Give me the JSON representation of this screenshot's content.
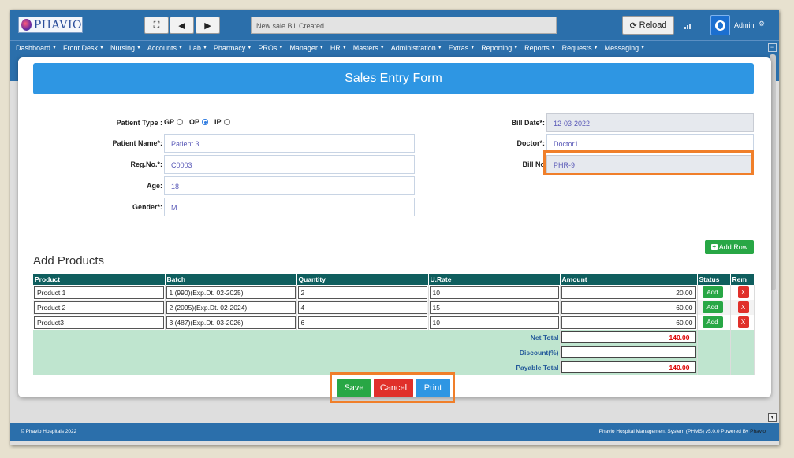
{
  "header": {
    "brand": "PHAVIO",
    "notification": "New sale Bill Created",
    "reload_label": "Reload",
    "user_name": "Admin"
  },
  "menu": [
    "Dashboard",
    "Front Desk",
    "Nursing",
    "Accounts",
    "Lab",
    "Pharmacy",
    "PROs",
    "Manager",
    "HR",
    "Masters",
    "Administration",
    "Extras",
    "Reporting",
    "Reports",
    "Requests",
    "Messaging"
  ],
  "form": {
    "title": "Sales Entry Form",
    "patient_type_label": "Patient Type :",
    "patient_type_options": [
      "GP",
      "OP",
      "IP"
    ],
    "patient_type_selected": "OP",
    "patient_name_label": "Patient Name*:",
    "patient_name": "Patient 3",
    "regno_label": "Reg.No.*:",
    "regno": "C0003",
    "age_label": "Age:",
    "age": "18",
    "gender_label": "Gender*:",
    "gender": "M",
    "bill_date_label": "Bill Date*:",
    "bill_date": "12-03-2022",
    "doctor_label": "Doctor*:",
    "doctor": "Doctor1",
    "bill_no_label": "Bill No",
    "bill_no": "PHR-9"
  },
  "products": {
    "section_title": "Add Products",
    "add_row_label": "Add Row",
    "columns": [
      "Product",
      "Batch",
      "Quantity",
      "U.Rate",
      "Amount",
      "Status",
      "Rem"
    ],
    "rows": [
      {
        "product": "Product 1",
        "batch": "1 (990)(Exp.Dt. 02-2025)",
        "quantity": "2",
        "rate": "10",
        "amount": "20.00",
        "status_btn": "Add",
        "remove_btn": "X"
      },
      {
        "product": "Product 2",
        "batch": "2 (2095)(Exp.Dt. 02-2024)",
        "quantity": "4",
        "rate": "15",
        "amount": "60.00",
        "status_btn": "Add",
        "remove_btn": "X"
      },
      {
        "product": "Product3",
        "batch": "3 (487)(Exp.Dt. 03-2026)",
        "quantity": "6",
        "rate": "10",
        "amount": "60.00",
        "status_btn": "Add",
        "remove_btn": "X"
      }
    ],
    "net_total_label": "Net Total",
    "net_total": "140.00",
    "discount_label": "Discount(%)",
    "discount": "",
    "payable_label": "Payable Total",
    "payable_total": "140.00"
  },
  "actions": {
    "save": "Save",
    "cancel": "Cancel",
    "print": "Print"
  },
  "footer": {
    "left": "© Phavio Hospitals 2022",
    "right": "Phavio Hospital Management System (PHMS) v5.0.0 Powered By",
    "right_brand": "Phavio"
  },
  "colors": {
    "primary": "#2b6fab",
    "title_bar": "#2e96e3",
    "table_header": "#0f5e5e",
    "totals_bg": "#bfe5cf",
    "success": "#28a745",
    "danger": "#e0302a",
    "highlight": "#f07f2a"
  }
}
